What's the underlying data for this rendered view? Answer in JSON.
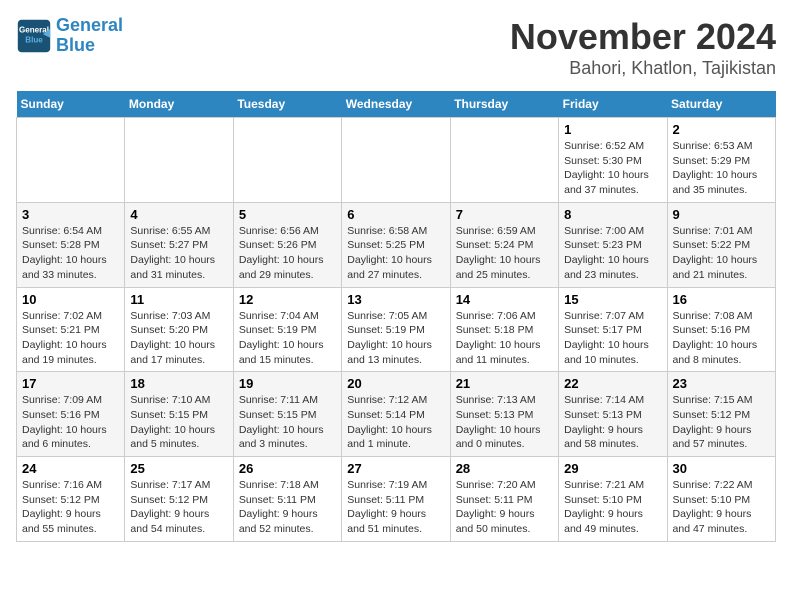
{
  "logo": {
    "line1": "General",
    "line2": "Blue"
  },
  "title": "November 2024",
  "location": "Bahori, Khatlon, Tajikistan",
  "days_of_week": [
    "Sunday",
    "Monday",
    "Tuesday",
    "Wednesday",
    "Thursday",
    "Friday",
    "Saturday"
  ],
  "weeks": [
    [
      {
        "day": "",
        "info": ""
      },
      {
        "day": "",
        "info": ""
      },
      {
        "day": "",
        "info": ""
      },
      {
        "day": "",
        "info": ""
      },
      {
        "day": "",
        "info": ""
      },
      {
        "day": "1",
        "info": "Sunrise: 6:52 AM\nSunset: 5:30 PM\nDaylight: 10 hours and 37 minutes."
      },
      {
        "day": "2",
        "info": "Sunrise: 6:53 AM\nSunset: 5:29 PM\nDaylight: 10 hours and 35 minutes."
      }
    ],
    [
      {
        "day": "3",
        "info": "Sunrise: 6:54 AM\nSunset: 5:28 PM\nDaylight: 10 hours and 33 minutes."
      },
      {
        "day": "4",
        "info": "Sunrise: 6:55 AM\nSunset: 5:27 PM\nDaylight: 10 hours and 31 minutes."
      },
      {
        "day": "5",
        "info": "Sunrise: 6:56 AM\nSunset: 5:26 PM\nDaylight: 10 hours and 29 minutes."
      },
      {
        "day": "6",
        "info": "Sunrise: 6:58 AM\nSunset: 5:25 PM\nDaylight: 10 hours and 27 minutes."
      },
      {
        "day": "7",
        "info": "Sunrise: 6:59 AM\nSunset: 5:24 PM\nDaylight: 10 hours and 25 minutes."
      },
      {
        "day": "8",
        "info": "Sunrise: 7:00 AM\nSunset: 5:23 PM\nDaylight: 10 hours and 23 minutes."
      },
      {
        "day": "9",
        "info": "Sunrise: 7:01 AM\nSunset: 5:22 PM\nDaylight: 10 hours and 21 minutes."
      }
    ],
    [
      {
        "day": "10",
        "info": "Sunrise: 7:02 AM\nSunset: 5:21 PM\nDaylight: 10 hours and 19 minutes."
      },
      {
        "day": "11",
        "info": "Sunrise: 7:03 AM\nSunset: 5:20 PM\nDaylight: 10 hours and 17 minutes."
      },
      {
        "day": "12",
        "info": "Sunrise: 7:04 AM\nSunset: 5:19 PM\nDaylight: 10 hours and 15 minutes."
      },
      {
        "day": "13",
        "info": "Sunrise: 7:05 AM\nSunset: 5:19 PM\nDaylight: 10 hours and 13 minutes."
      },
      {
        "day": "14",
        "info": "Sunrise: 7:06 AM\nSunset: 5:18 PM\nDaylight: 10 hours and 11 minutes."
      },
      {
        "day": "15",
        "info": "Sunrise: 7:07 AM\nSunset: 5:17 PM\nDaylight: 10 hours and 10 minutes."
      },
      {
        "day": "16",
        "info": "Sunrise: 7:08 AM\nSunset: 5:16 PM\nDaylight: 10 hours and 8 minutes."
      }
    ],
    [
      {
        "day": "17",
        "info": "Sunrise: 7:09 AM\nSunset: 5:16 PM\nDaylight: 10 hours and 6 minutes."
      },
      {
        "day": "18",
        "info": "Sunrise: 7:10 AM\nSunset: 5:15 PM\nDaylight: 10 hours and 5 minutes."
      },
      {
        "day": "19",
        "info": "Sunrise: 7:11 AM\nSunset: 5:15 PM\nDaylight: 10 hours and 3 minutes."
      },
      {
        "day": "20",
        "info": "Sunrise: 7:12 AM\nSunset: 5:14 PM\nDaylight: 10 hours and 1 minute."
      },
      {
        "day": "21",
        "info": "Sunrise: 7:13 AM\nSunset: 5:13 PM\nDaylight: 10 hours and 0 minutes."
      },
      {
        "day": "22",
        "info": "Sunrise: 7:14 AM\nSunset: 5:13 PM\nDaylight: 9 hours and 58 minutes."
      },
      {
        "day": "23",
        "info": "Sunrise: 7:15 AM\nSunset: 5:12 PM\nDaylight: 9 hours and 57 minutes."
      }
    ],
    [
      {
        "day": "24",
        "info": "Sunrise: 7:16 AM\nSunset: 5:12 PM\nDaylight: 9 hours and 55 minutes."
      },
      {
        "day": "25",
        "info": "Sunrise: 7:17 AM\nSunset: 5:12 PM\nDaylight: 9 hours and 54 minutes."
      },
      {
        "day": "26",
        "info": "Sunrise: 7:18 AM\nSunset: 5:11 PM\nDaylight: 9 hours and 52 minutes."
      },
      {
        "day": "27",
        "info": "Sunrise: 7:19 AM\nSunset: 5:11 PM\nDaylight: 9 hours and 51 minutes."
      },
      {
        "day": "28",
        "info": "Sunrise: 7:20 AM\nSunset: 5:11 PM\nDaylight: 9 hours and 50 minutes."
      },
      {
        "day": "29",
        "info": "Sunrise: 7:21 AM\nSunset: 5:10 PM\nDaylight: 9 hours and 49 minutes."
      },
      {
        "day": "30",
        "info": "Sunrise: 7:22 AM\nSunset: 5:10 PM\nDaylight: 9 hours and 47 minutes."
      }
    ]
  ]
}
